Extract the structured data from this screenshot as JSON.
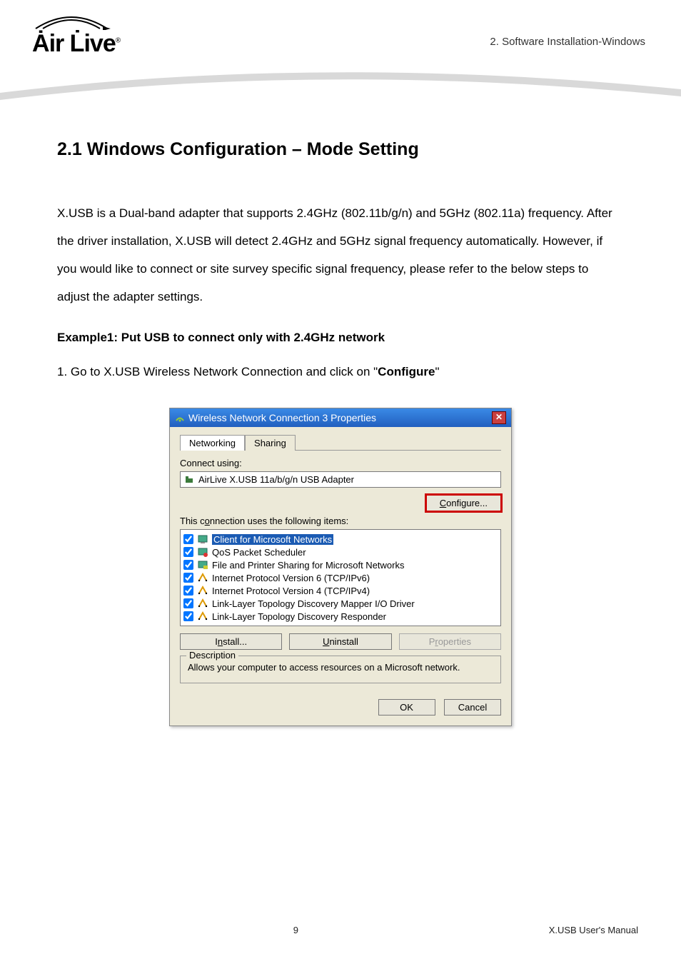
{
  "header": {
    "crumb": "2. Software Installation-Windows",
    "logo_text_1": "A",
    "logo_text_2": "ir L",
    "logo_text_3": "ive"
  },
  "section": {
    "title": "2.1 Windows Configuration – Mode Setting",
    "para": "X.USB is a Dual-band adapter that supports 2.4GHz (802.11b/g/n) and 5GHz (802.11a) frequency. After the driver installation, X.USB will detect 2.4GHz and 5GHz signal frequency automatically. However, if you would like to connect or site survey specific signal frequency, please refer to the below steps to adjust the adapter settings.",
    "example_title": "Example1: Put USB to connect only with 2.4GHz network",
    "step1_pre": "1. Go to X.USB Wireless Network Connection and click on \"",
    "step1_bold": "Configure",
    "step1_post": "\""
  },
  "dialog": {
    "title": "Wireless Network Connection 3 Properties",
    "tab1": "Networking",
    "tab2": "Sharing",
    "connect_using": "Connect using:",
    "adapter": "AirLive X.USB 11a/b/g/n USB Adapter",
    "configure": "Configure...",
    "uses_items": "This connection uses the following items:",
    "items": [
      "Client for Microsoft Networks",
      "QoS Packet Scheduler",
      "File and Printer Sharing for Microsoft Networks",
      "Internet Protocol Version 6 (TCP/IPv6)",
      "Internet Protocol Version 4 (TCP/IPv4)",
      "Link-Layer Topology Discovery Mapper I/O Driver",
      "Link-Layer Topology Discovery Responder"
    ],
    "install": "Install...",
    "uninstall": "Uninstall",
    "properties": "Properties",
    "desc_title": "Description",
    "desc_text": "Allows your computer to access resources on a Microsoft network.",
    "ok": "OK",
    "cancel": "Cancel"
  },
  "footer": {
    "page": "9",
    "manual": "X.USB User's Manual"
  }
}
